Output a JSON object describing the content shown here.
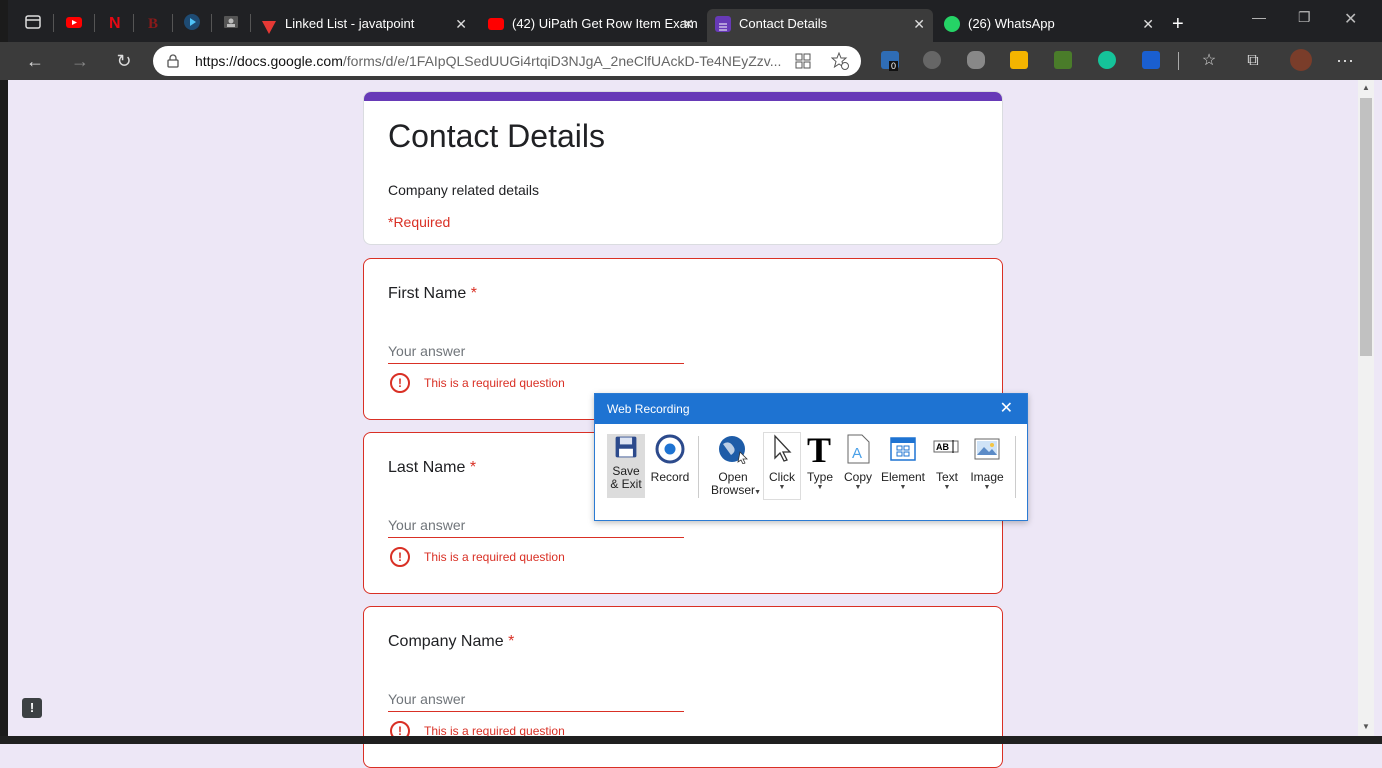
{
  "browser": {
    "tabs": [
      {
        "title": "Linked List - javatpoint",
        "fav_color": "#e53935"
      },
      {
        "title": "(42) UiPath Get Row Item Exam",
        "fav_color": "#ff0000"
      },
      {
        "title": "Contact Details",
        "fav_color": "#673ab7"
      },
      {
        "title": "(26) WhatsApp",
        "fav_color": "#25d366"
      }
    ],
    "new_tab": "+",
    "url_domain": "https://docs.google.com",
    "url_path": "/forms/d/e/1FAIpQLSedUUGi4rtqiD3NJgA_2neClfUAckD-Te4NEyZzv...",
    "ext_badge": "0"
  },
  "form": {
    "title": "Contact Details",
    "description": "Company related details",
    "required_note": "*Required",
    "questions": [
      {
        "label": "First Name",
        "star": "*",
        "placeholder": "Your answer",
        "error": "This is a required question"
      },
      {
        "label": "Last Name",
        "star": "*",
        "placeholder": "Your answer",
        "error": "This is a required question"
      },
      {
        "label": "Company Name",
        "star": "*",
        "placeholder": "Your answer",
        "error": "This is a required question"
      }
    ]
  },
  "recorder": {
    "title": "Web Recording",
    "tools": {
      "save": "Save & Exit",
      "record": "Record",
      "open_browser": "Open Browser",
      "click": "Click",
      "type": "Type",
      "copy": "Copy",
      "element": "Element",
      "text": "Text",
      "image": "Image"
    }
  }
}
